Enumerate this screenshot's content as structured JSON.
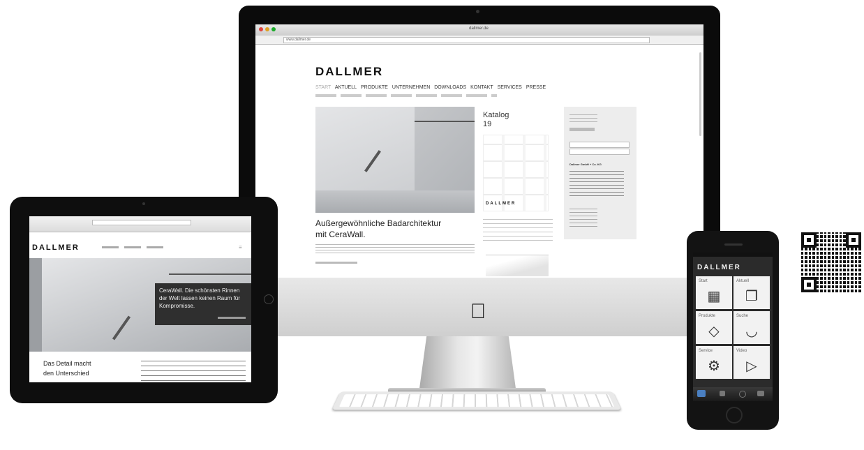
{
  "desktop": {
    "window_url": "dallmer.de",
    "address": "www.dallmer.de",
    "logo": "DALLMER",
    "nav": [
      "START",
      "AKTUELL",
      "PRODUKTE",
      "UNTERNEHMEN",
      "DOWNLOADS",
      "KONTAKT",
      "SERVICES",
      "PRESSE"
    ],
    "headline_line1": "Außergewöhnliche Badarchitektur",
    "headline_line2": "mit CeraWall.",
    "catalog_title": "Katalog",
    "catalog_num": "19",
    "catalog_brand": "DALLMER",
    "sidebar_address": "Dallmer GmbH + Co. KG"
  },
  "tablet": {
    "logo": "DALLMER",
    "hero_overlay": "CeraWall. Die schönsten Rinnen der Welt lassen keinen Raum für Kompromisse.",
    "teaser_line1": "Das Detail macht",
    "teaser_line2": "den Unterschied"
  },
  "phone": {
    "logo": "DALLMER",
    "tiles": [
      {
        "label": "Start",
        "icon": "grid-icon",
        "glyph": "▦"
      },
      {
        "label": "Aktuell",
        "icon": "document-icon",
        "glyph": "❐"
      },
      {
        "label": "Produkte",
        "icon": "diamond-icon",
        "glyph": "◇"
      },
      {
        "label": "Suche",
        "icon": "arc-icon",
        "glyph": "◡"
      },
      {
        "label": "Service",
        "icon": "gear-icon",
        "glyph": "⚙"
      },
      {
        "label": "Video",
        "icon": "play-icon",
        "glyph": "▷"
      }
    ]
  },
  "colors": {
    "accent": "#111111",
    "screen_gray": "#ededed",
    "overlay": "#2f2f2f"
  }
}
